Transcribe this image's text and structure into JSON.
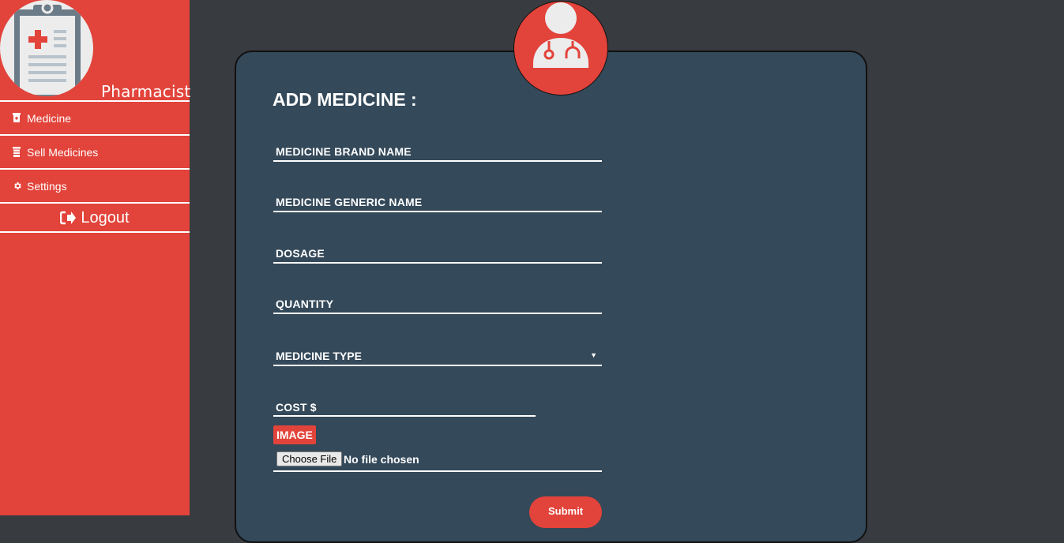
{
  "sidebar": {
    "role": "Pharmacist",
    "items": [
      {
        "label": "Medicine",
        "icon": "medicine-bottle-icon"
      },
      {
        "label": "Sell Medicines",
        "icon": "medicine-jar-icon"
      },
      {
        "label": "Settings",
        "icon": "gear-icon"
      }
    ],
    "logout": {
      "label": "Logout",
      "icon": "sign-out-icon"
    },
    "avatar_icon": "clipboard-medical-icon"
  },
  "form": {
    "badge_icon": "doctor-icon",
    "title": "ADD MEDICINE :",
    "fields": {
      "brand_name": "MEDICINE BRAND NAME",
      "generic_name": "MEDICINE GENERIC NAME",
      "dosage": "DOSAGE",
      "quantity": "QUANTITY",
      "cost": "COST $"
    },
    "medicine_type": {
      "selected": "MEDICINE TYPE"
    },
    "image_label": "IMAGE",
    "file_button": "Choose File",
    "file_status": "No file chosen",
    "submit": "Submit"
  },
  "colors": {
    "accent": "#e2433a",
    "background": "#383c40",
    "card": "#34495a"
  }
}
